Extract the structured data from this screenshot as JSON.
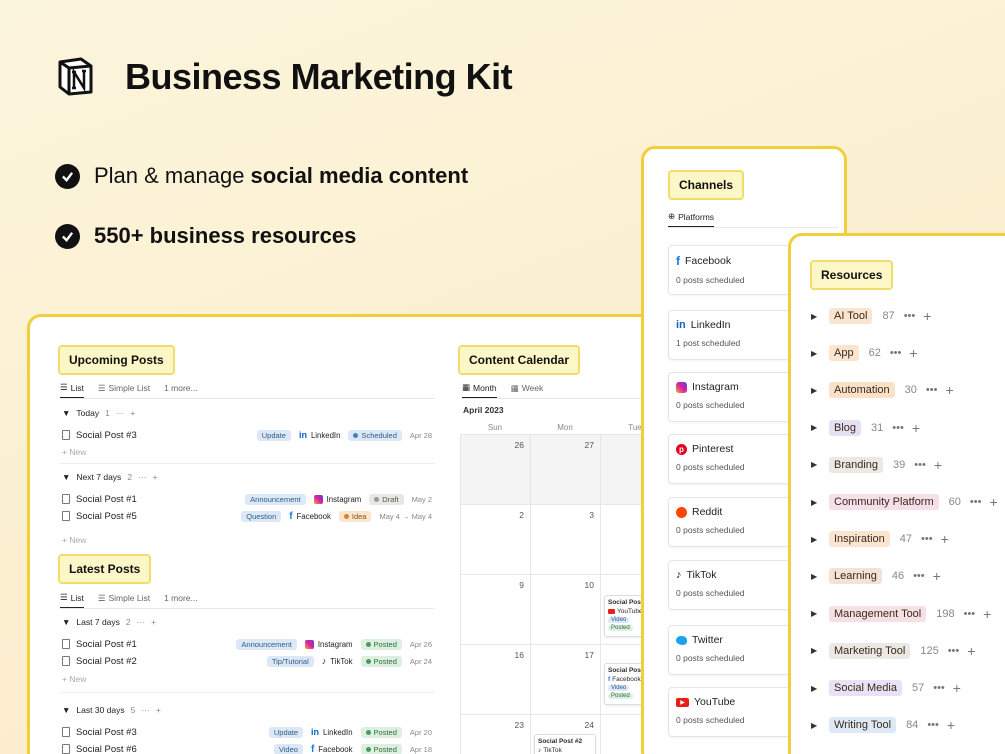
{
  "header": {
    "title": "Business Marketing Kit",
    "features": [
      {
        "pre": "Plan & manage ",
        "bold": "social media content"
      },
      {
        "pre": "",
        "bold": "550+ business resources"
      }
    ]
  },
  "upcoming": {
    "heading": "Upcoming Posts",
    "tabs": [
      "List",
      "Simple List",
      "1 more..."
    ],
    "groups": [
      {
        "label": "Today",
        "count": "1"
      },
      {
        "label": "Next 7 days",
        "count": "2"
      }
    ],
    "new_label": "New",
    "rows": [
      {
        "name": "Social Post #3",
        "type": "Update",
        "platform": "LinkedIn",
        "status": "Scheduled",
        "date": "Apr 28"
      },
      {
        "name": "Social Post #1",
        "type": "Announcement",
        "platform": "Instagram",
        "status": "Draft",
        "date": "May 2"
      },
      {
        "name": "Social Post #5",
        "type": "Question",
        "platform": "Facebook",
        "status": "Idea",
        "date": "May 4 → May 4"
      }
    ]
  },
  "latest": {
    "heading": "Latest Posts",
    "tabs": [
      "List",
      "Simple List",
      "1 more..."
    ],
    "groups": [
      {
        "label": "Last 7 days",
        "count": "2"
      },
      {
        "label": "Last 30 days",
        "count": "5"
      }
    ],
    "rows": [
      {
        "name": "Social Post #1",
        "type": "Announcement",
        "platform": "Instagram",
        "status": "Posted",
        "date": "Apr 26"
      },
      {
        "name": "Social Post #2",
        "type": "Tip/Tutorial",
        "platform": "TikTok",
        "status": "Posted",
        "date": "Apr 24"
      },
      {
        "name": "Social Post #3",
        "type": "Update",
        "platform": "LinkedIn",
        "status": "Posted",
        "date": "Apr 20"
      },
      {
        "name": "Social Post #6",
        "type": "Video",
        "platform": "Facebook",
        "status": "Posted",
        "date": "Apr 18"
      }
    ]
  },
  "calendar": {
    "heading": "Content Calendar",
    "tabs": [
      "Month",
      "Week"
    ],
    "month": "April 2023",
    "weekdays": [
      "Sun",
      "Mon",
      "Tue"
    ],
    "days": [
      [
        "26",
        "27",
        ""
      ],
      [
        "2",
        "3",
        ""
      ],
      [
        "9",
        "10",
        ""
      ],
      [
        "16",
        "17",
        ""
      ],
      [
        "23",
        "24",
        ""
      ]
    ],
    "cards": [
      {
        "title": "Social Post",
        "platform": "YouTube",
        "type": "Video",
        "status": "Posted"
      },
      {
        "title": "Social Post",
        "platform": "Facebook",
        "type": "Video",
        "status": "Posted"
      },
      {
        "title": "Social Post #2",
        "platform": "TikTok"
      }
    ]
  },
  "channels": {
    "heading": "Channels",
    "tab": "Platforms",
    "items": [
      {
        "name": "Facebook",
        "sub": "0 posts scheduled"
      },
      {
        "name": "LinkedIn",
        "sub": "1 post scheduled"
      },
      {
        "name": "Instagram",
        "sub": "0 posts scheduled"
      },
      {
        "name": "Pinterest",
        "sub": "0 posts scheduled"
      },
      {
        "name": "Reddit",
        "sub": "0 posts scheduled"
      },
      {
        "name": "TikTok",
        "sub": "0 posts scheduled"
      },
      {
        "name": "Twitter",
        "sub": "0 posts scheduled"
      },
      {
        "name": "YouTube",
        "sub": "0 posts scheduled"
      }
    ]
  },
  "resources": {
    "heading": "Resources",
    "items": [
      {
        "label": "AI Tool",
        "count": "87",
        "color": "#fbe4d0"
      },
      {
        "label": "App",
        "count": "62",
        "color": "#fbe4d0"
      },
      {
        "label": "Automation",
        "count": "30",
        "color": "#fbe1c8"
      },
      {
        "label": "Blog",
        "count": "31",
        "color": "#e6e0f5"
      },
      {
        "label": "Branding",
        "count": "39",
        "color": "#ece8e3"
      },
      {
        "label": "Community Platform",
        "count": "60",
        "color": "#f5dfe9"
      },
      {
        "label": "Inspiration",
        "count": "47",
        "color": "#fbe4d0"
      },
      {
        "label": "Learning",
        "count": "46",
        "color": "#f5e2d7"
      },
      {
        "label": "Management Tool",
        "count": "198",
        "color": "#f7e0e4"
      },
      {
        "label": "Marketing Tool",
        "count": "125",
        "color": "#ece8e3"
      },
      {
        "label": "Social Media",
        "count": "57",
        "color": "#e9e1f5"
      },
      {
        "label": "Writing Tool",
        "count": "84",
        "color": "#dde9f5"
      }
    ]
  }
}
